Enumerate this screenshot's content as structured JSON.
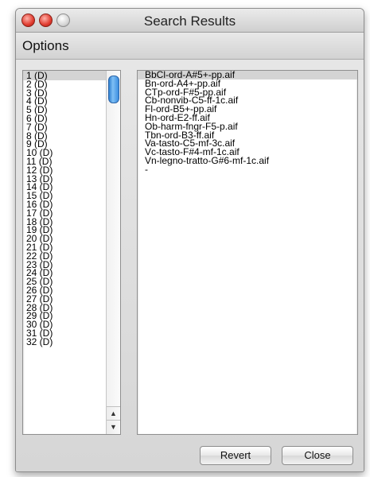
{
  "window": {
    "title": "Search Results"
  },
  "menubar": {
    "options": "Options"
  },
  "left_list": {
    "items": [
      "1 (D)",
      "2 (D)",
      "3 (D)",
      "4 (D)",
      "5 (D)",
      "6 (D)",
      "7 (D)",
      "8 (D)",
      "9 (D)",
      "10 (D)",
      "11 (D)",
      "12 (D)",
      "13 (D)",
      "14 (D)",
      "15 (D)",
      "16 (D)",
      "17 (D)",
      "18 (D)",
      "19 (D)",
      "20 (D)",
      "21 (D)",
      "22 (D)",
      "23 (D)",
      "24 (D)",
      "25 (D)",
      "26 (D)",
      "27 (D)",
      "28 (D)",
      "29 (D)",
      "30 (D)",
      "31 (D)",
      "32 (D)"
    ],
    "selected_index": 0,
    "scroll_up_icon": "▲",
    "scroll_down_icon": "▼"
  },
  "right_list": {
    "items": [
      "BbCl-ord-A#5+-pp.aif",
      "Bn-ord-A4+-pp.aif",
      "CTp-ord-F#5-pp.aif",
      "Cb-nonvib-C5-ff-1c.aif",
      "Fl-ord-B5+-pp.aif",
      "Hn-ord-E2-ff.aif",
      "Ob-harm-fngr-F5-p.aif",
      "Tbn-ord-B3-ff.aif",
      "Va-tasto-C5-mf-3c.aif",
      "Vc-tasto-F#4-mf-1c.aif",
      "Vn-legno-tratto-G#6-mf-1c.aif",
      "-"
    ],
    "selected_index": 0
  },
  "buttons": {
    "revert": "Revert",
    "close": "Close"
  }
}
